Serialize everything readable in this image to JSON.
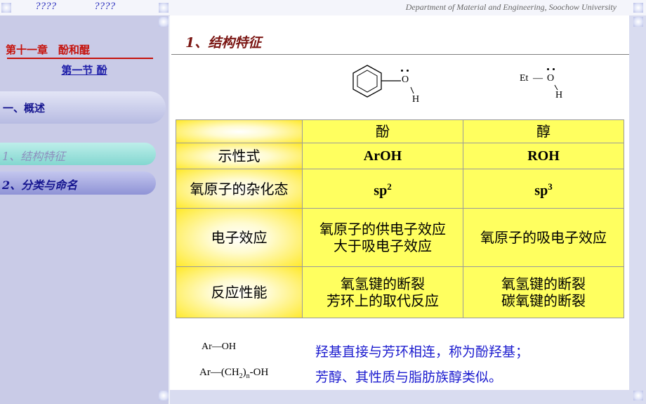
{
  "nav": {
    "prev": "????",
    "next": "????"
  },
  "header": {
    "department": "Department of Material and Engineering, Soochow University"
  },
  "sidebar": {
    "chapter_title": "第十一章　酚和醌",
    "section_title": "第一节 酚",
    "items": [
      {
        "label": "一、概述"
      },
      {
        "label": "1、结构特征"
      },
      {
        "label": "2、分类与命名"
      }
    ]
  },
  "main": {
    "title": "1、结构特征",
    "phenol_structure": {
      "o": "O",
      "h": "H"
    },
    "ethanol_structure": {
      "et": "Et",
      "bond": "—",
      "o": "O",
      "h": "H"
    },
    "table": {
      "headers": [
        "",
        "酚",
        "醇"
      ],
      "rows": [
        {
          "label": "示性式",
          "phenol": "ArOH",
          "alcohol": "ROH"
        },
        {
          "label": "氧原子的杂化态",
          "phenol_base": "sp",
          "phenol_sup": "2",
          "alcohol_base": "sp",
          "alcohol_sup": "3"
        },
        {
          "label": "电子效应",
          "phenol": [
            "氧原子的供电子效应",
            "大于吸电子效应"
          ],
          "alcohol": [
            "氧原子的吸电子效应"
          ]
        },
        {
          "label": "反应性能",
          "phenol": [
            "氧氢键的断裂",
            "芳环上的取代反应"
          ],
          "alcohol": [
            "氧氢键的断裂",
            "碳氧键的断裂"
          ]
        }
      ]
    },
    "formulas": {
      "f1": {
        "ar": "Ar",
        "dash": "—",
        "oh": "OH"
      },
      "f2": {
        "ar": "Ar",
        "dash1": "—",
        "ch2": "(CH",
        "sub2": "2",
        "close": ")",
        "subn": "n",
        "dash2": "-",
        "oh": "OH"
      }
    },
    "notes": [
      "羟基直接与芳环相连，称为酚羟基；",
      "芳醇、其性质与脂肪族醇类似。"
    ]
  }
}
